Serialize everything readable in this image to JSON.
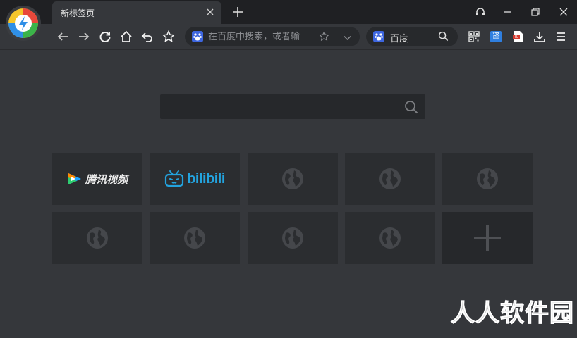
{
  "browser": {
    "tab": {
      "title": "新标签页"
    }
  },
  "toolbar": {
    "address_placeholder": "在百度中搜索，或者输",
    "search_engine": "百度",
    "translate_label": "译"
  },
  "main": {
    "search_placeholder": "",
    "tiles": [
      {
        "type": "site",
        "label": "腾讯视频",
        "icon": "tencent-video-icon"
      },
      {
        "type": "site",
        "label": "bilibili",
        "icon": "bilibili-icon"
      },
      {
        "type": "empty",
        "icon": "globe-icon"
      },
      {
        "type": "empty",
        "icon": "globe-icon"
      },
      {
        "type": "empty",
        "icon": "globe-icon"
      },
      {
        "type": "empty",
        "icon": "globe-icon"
      },
      {
        "type": "empty",
        "icon": "globe-icon"
      },
      {
        "type": "empty",
        "icon": "globe-icon"
      },
      {
        "type": "empty",
        "icon": "globe-icon"
      },
      {
        "type": "add",
        "icon": "plus-icon"
      }
    ]
  },
  "watermark": "人人软件园",
  "colors": {
    "background": "#35373b",
    "titlebar": "#1f2023",
    "tile": "#2b2d30",
    "bilibili_blue": "#23a3de"
  }
}
